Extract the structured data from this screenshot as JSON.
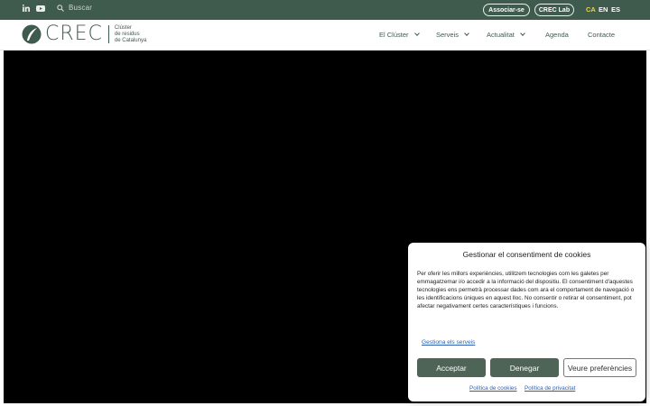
{
  "topbar": {
    "social": [
      "linkedin-icon",
      "youtube-icon"
    ],
    "search_label": "Buscar",
    "associate_label": "Associar-se",
    "lab_label": "CREC Lab",
    "languages": [
      "CA",
      "EN",
      "ES"
    ],
    "active_language": "CA"
  },
  "header": {
    "logo_word": "CREC",
    "logo_tag_1": "Clúster",
    "logo_tag_2": "de residus",
    "logo_tag_3": "de Catalunya",
    "nav": [
      "El Clúster",
      "Serveis",
      "Actualitat",
      "Agenda",
      "Contacte"
    ]
  },
  "cookie": {
    "title": "Gestionar el consentiment de cookies",
    "body": "Per oferir les millors experiències, utilitzem tecnologies com les galetes per emmagatzemar i/o accedir a la informació del dispositiu. El consentiment d'aquestes tecnologies ens permetrà processar dades com ara el comportament de navegació o les identificacions úniques en aquest lloc. No consentir o retirar el consentiment, pot afectar negativament certes característiques i funcions.",
    "manage_link": "Gestiona els serveis",
    "accept": "Acceptar",
    "deny": "Denegar",
    "preferences": "Veure preferències",
    "cookie_policy": "Política de cookies",
    "privacy_policy": "Política de privacitat"
  },
  "colors": {
    "brand_green": "#3f5b4d",
    "accent_yellow": "#e8d44d",
    "button_green": "#4d6457",
    "link_blue": "#2b5fb3"
  }
}
